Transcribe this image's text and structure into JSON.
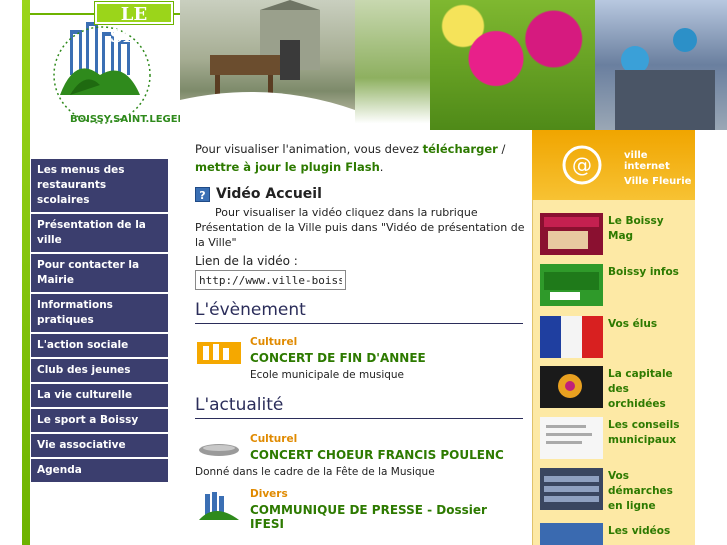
{
  "logo": {
    "site_label": "LE SITE",
    "town": "BOISSY.SAINT.LEGER"
  },
  "menu": [
    "Les menus des restaurants scolaires",
    "Présentation de la ville",
    "Pour contacter la Mairie",
    "Informations pratiques",
    "L'action sociale",
    "Club des jeunes",
    "La vie culturelle",
    "Le sport a Boissy",
    "Vie associative",
    "Agenda"
  ],
  "flash": {
    "text_before": "Pour visualiser l'animation, vous devez ",
    "link1": "télécharger",
    "sep": " / ",
    "link2": "mettre à jour le plugin Flash",
    "text_after": "."
  },
  "video": {
    "title": "Vidéo Accueil",
    "description": "Pour visualiser la vidéo cliquez dans la rubrique Présentation de la Ville puis dans \"Vidéo de présentation de la Ville\"",
    "link_label": "Lien de la vidéo :",
    "link_value": "http://www.ville-boissy-saint-leger.fr"
  },
  "evenement": {
    "title": "L'évènement",
    "items": [
      {
        "category": "Culturel",
        "title": "CONCERT DE FIN D'ANNEE",
        "desc": "Ecole municipale de musique"
      }
    ]
  },
  "actualite": {
    "title": "L'actualité",
    "items": [
      {
        "category": "Culturel",
        "title": "CONCERT CHOEUR FRANCIS POULENC",
        "desc": "Donné dans le cadre de la Fête de la Musique"
      },
      {
        "category": "Divers",
        "title": "COMMUNIQUE DE PRESSE - Dossier IFESI",
        "desc": ""
      }
    ]
  },
  "right_banner": {
    "line1": "ville internet",
    "line2": "Ville Fleurie"
  },
  "right_links": [
    "Le Boissy Mag",
    "Boissy infos",
    "Vos élus",
    "La capitale des orchidées",
    "Les conseils municipaux",
    "Vos démarches en ligne",
    "Les vidéos"
  ],
  "colors": {
    "menu_bg": "#3b3e6e",
    "link_green": "#2d7a00",
    "category_orange": "#e08a00",
    "right_bg": "#fde9a5"
  }
}
